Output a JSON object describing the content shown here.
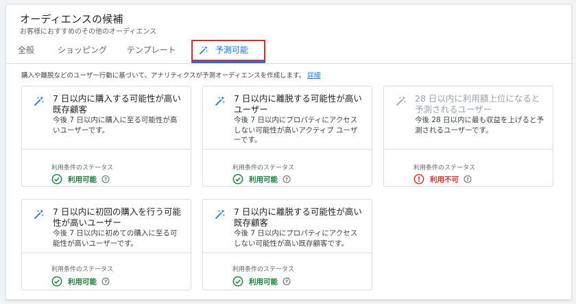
{
  "header": {
    "title": "オーディエンスの候補",
    "subtitle": "お客様におすすめのその他のオーディエンス"
  },
  "tabs": [
    {
      "label": "全般"
    },
    {
      "label": "ショッピング"
    },
    {
      "label": "テンプレート"
    },
    {
      "label": "予測可能"
    }
  ],
  "description": {
    "text": "購入や離脱などのユーザー行動に基づいて、アナリティクスが予測オーディエンスを作成します。",
    "link": "詳細"
  },
  "colors": {
    "accent": "#1a73e8",
    "ok": "#188038",
    "error": "#d93025",
    "highlight_box": "#e8261e"
  },
  "cards": [
    {
      "title": "7 日以内に購入する可能性が高い既存顧客",
      "description": "今後 7 日以内に購入に至る可能性が高いユーザーです。",
      "status_label": "利用条件のステータス",
      "status": "利用可能",
      "available": true
    },
    {
      "title": "7 日以内に離脱する可能性が高いユーザー",
      "description": "今後 7 日以内にプロパティにアクセスしない可能性が高いアクティブ ユーザーです。",
      "status_label": "利用条件のステータス",
      "status": "利用可能",
      "available": true
    },
    {
      "title": "28 日以内に利用額上位になると予測されるユーザー",
      "description": "今後 28 日以内に最も収益を上げると予測されるユーザーです。",
      "status_label": "利用条件のステータス",
      "status": "利用不可",
      "available": false
    },
    {
      "title": "7 日以内に初回の購入を行う可能性が高いユーザー",
      "description": "今後 7 日以内に初めての購入に至る可能性が高いユーザーです。",
      "status_label": "利用条件のステータス",
      "status": "利用可能",
      "available": true
    },
    {
      "title": "7 日以内に離脱する可能性が高い既存顧客",
      "description": "今後 7 日以内にプロパティにアクセスしない可能性が高い既存顧客です。",
      "status_label": "利用条件のステータス",
      "status": "利用可能",
      "available": true
    }
  ]
}
